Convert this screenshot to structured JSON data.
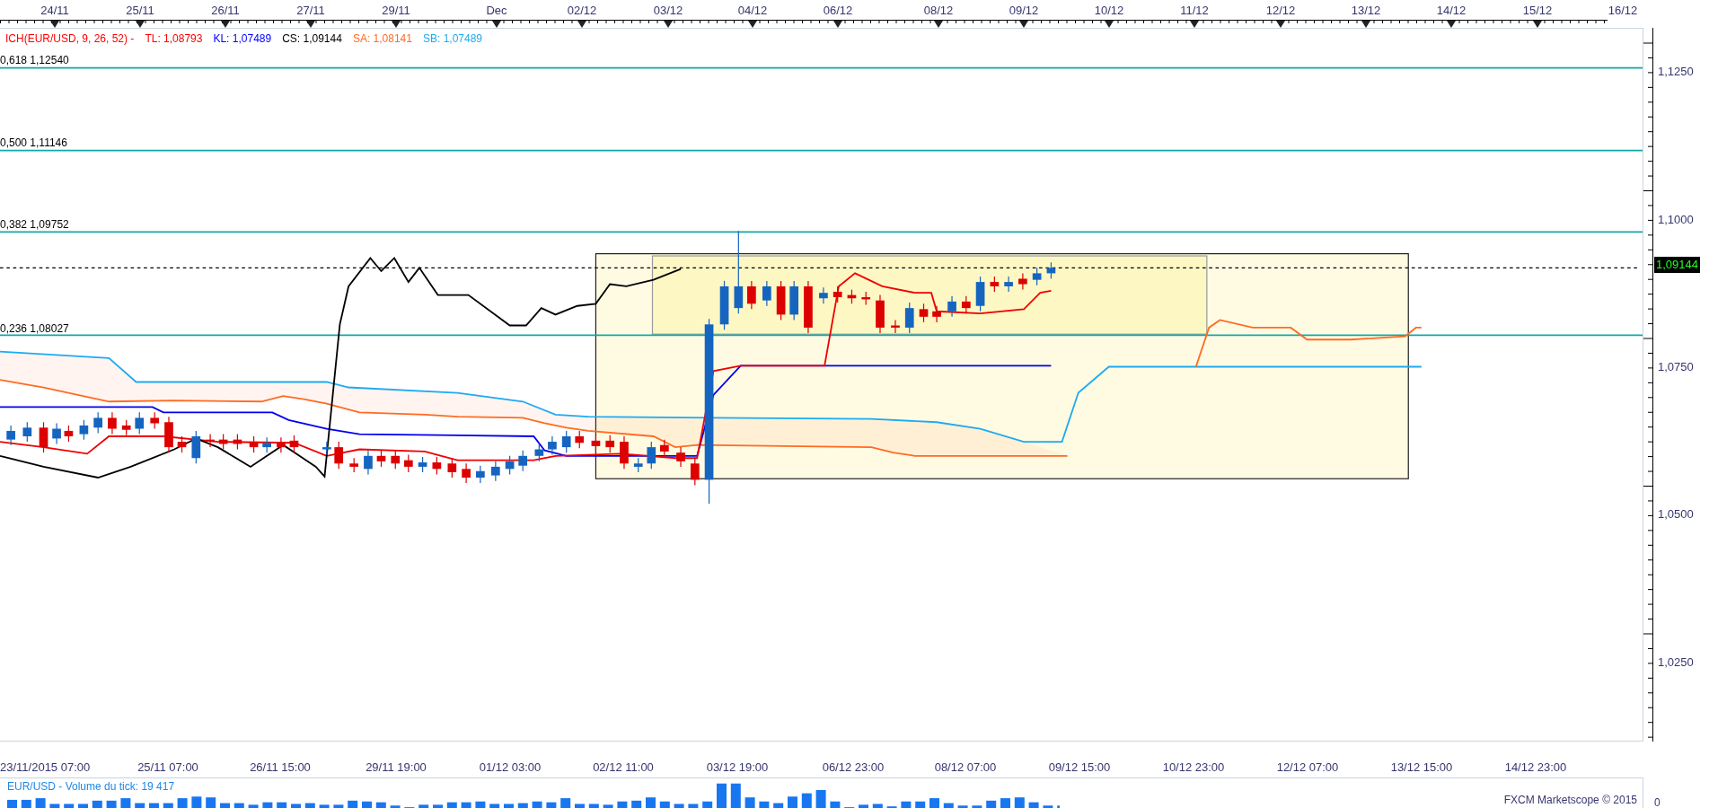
{
  "top_axis": {
    "labels": [
      "24/11",
      "25/11",
      "26/11",
      "27/11",
      "29/11",
      "Dec",
      "02/12",
      "03/12",
      "04/12",
      "06/12",
      "08/12",
      "09/12",
      "10/12",
      "11/12",
      "12/12",
      "13/12",
      "14/12",
      "15/12",
      "16/12"
    ]
  },
  "legend": {
    "indicator": "ICH(EUR/USD, 9, 26, 52) -",
    "values": [
      {
        "label": "TL: 1,08793",
        "color": "#ff0000"
      },
      {
        "label": "KL: 1,07489",
        "color": "#0000ff"
      },
      {
        "label": "CS: 1,09144",
        "color": "#000000"
      },
      {
        "label": "SA: 1,08141",
        "color": "#ff6a22"
      },
      {
        "label": "SB: 1,07489",
        "color": "#1eaaf1"
      }
    ]
  },
  "fib_levels": [
    {
      "label": "0,618 1,12540"
    },
    {
      "label": "0,500 1,11146"
    },
    {
      "label": "0,382 1,09752"
    },
    {
      "label": "0,236 1,08027"
    }
  ],
  "price_axis": {
    "labels": [
      "1,1250",
      "1,1000",
      "1,0750",
      "1,0500",
      "1,0250"
    ],
    "current_price": "1,09144"
  },
  "time_axis": {
    "labels": [
      "23/11/2015 07:00",
      "25/11 07:00",
      "26/11 15:00",
      "29/11 19:00",
      "01/12 03:00",
      "02/12 11:00",
      "03/12 19:00",
      "06/12 23:00",
      "08/12 07:00",
      "09/12 15:00",
      "10/12 23:00",
      "12/12 07:00",
      "13/12 15:00",
      "14/12 23:00"
    ]
  },
  "volume_panel": {
    "title": "EUR/USD - Volume du tick: 19 417",
    "axis_label": "0"
  },
  "copyright": "FXCM Marketscope © 2015"
}
